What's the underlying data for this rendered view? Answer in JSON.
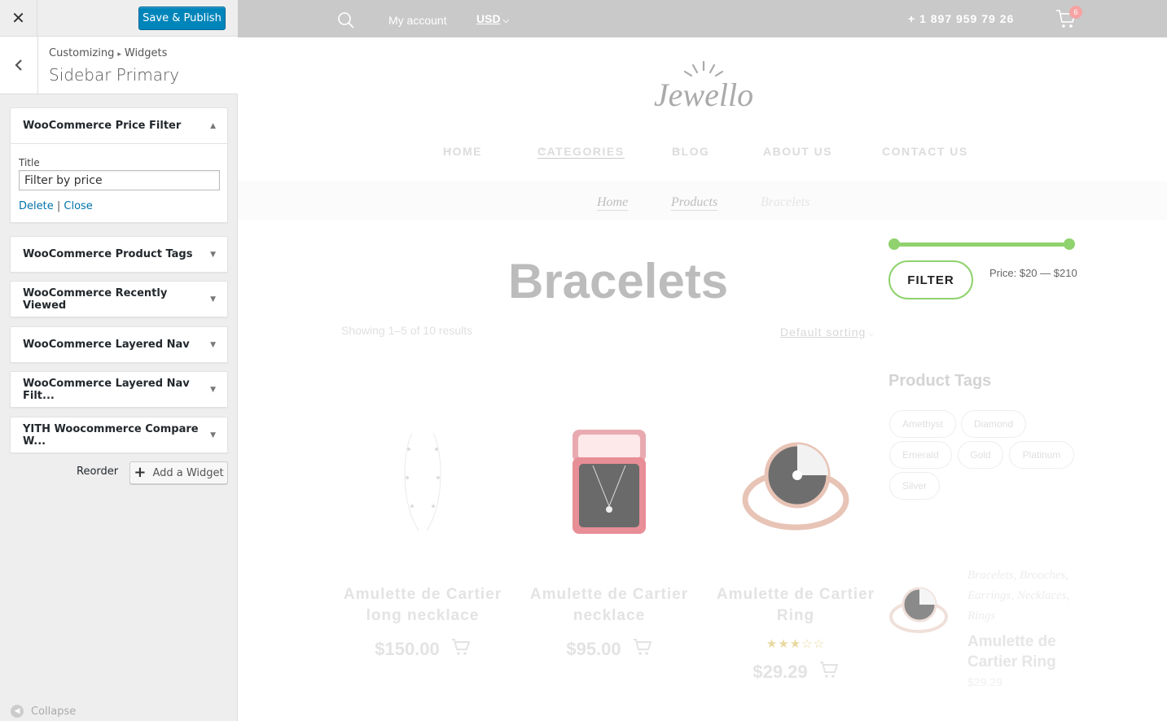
{
  "customizer": {
    "close_icon": "close-icon",
    "save_label": "Save & Publish",
    "breadcrumb": {
      "parent": "Customizing",
      "separator": "▸",
      "current": "Widgets"
    },
    "section_title": "Sidebar Primary",
    "widgets": [
      {
        "title": "WooCommerce Price Filter",
        "expanded": true
      },
      {
        "title": "WooCommerce Product Tags",
        "expanded": false
      },
      {
        "title": "WooCommerce Recently Viewed",
        "expanded": false
      },
      {
        "title": "WooCommerce Layered Nav",
        "expanded": false
      },
      {
        "title": "WooCommerce Layered Nav Filt...",
        "expanded": false
      },
      {
        "title": "YITH Woocommerce Compare W...",
        "expanded": false
      }
    ],
    "price_filter_form": {
      "title_label": "Title",
      "title_value": "Filter by price",
      "delete_label": "Delete",
      "link_separator": "|",
      "close_label": "Close"
    },
    "reorder_label": "Reorder",
    "add_widget_label": "Add a Widget",
    "collapse_label": "Collapse"
  },
  "site": {
    "topbar": {
      "account_label": "My account",
      "currency": "USD",
      "phone": "+ 1 897 959 79 26",
      "cart_count": "6"
    },
    "logo_text": "Jewello",
    "nav": [
      "HOME",
      "CATEGORIES",
      "BLOG",
      "ABOUT US",
      "CONTACT US"
    ],
    "breadcrumb": [
      "Home",
      "Products",
      "Bracelets"
    ],
    "page_title": "Bracelets",
    "result_count": "Showing 1–5 of 10 results",
    "sort_label": "Default sorting",
    "products": [
      {
        "name": "Amulette de Cartier long necklace",
        "price": "$150.00",
        "rating": null
      },
      {
        "name": "Amulette de Cartier necklace",
        "price": "$95.00",
        "rating": null
      },
      {
        "name": "Amulette de Cartier Ring",
        "price": "$29.29",
        "rating": 3
      }
    ],
    "price_filter": {
      "button_label": "FILTER",
      "range_text": "Price: $20 — $210",
      "range_min": 20,
      "range_max": 210
    },
    "product_tags": {
      "title": "Product Tags",
      "tags": [
        "Amethyst",
        "Diamond",
        "Emerald",
        "Gold",
        "Platinum",
        "Silver"
      ]
    },
    "sidebar_product": {
      "categories": "Bracelets, Brooches, Earrings, Necklaces, Rings",
      "name": "Amulette de Cartier Ring",
      "price": "$29.29"
    },
    "accent_color": "#8fd26e",
    "wp_blue": "#0085ba"
  }
}
